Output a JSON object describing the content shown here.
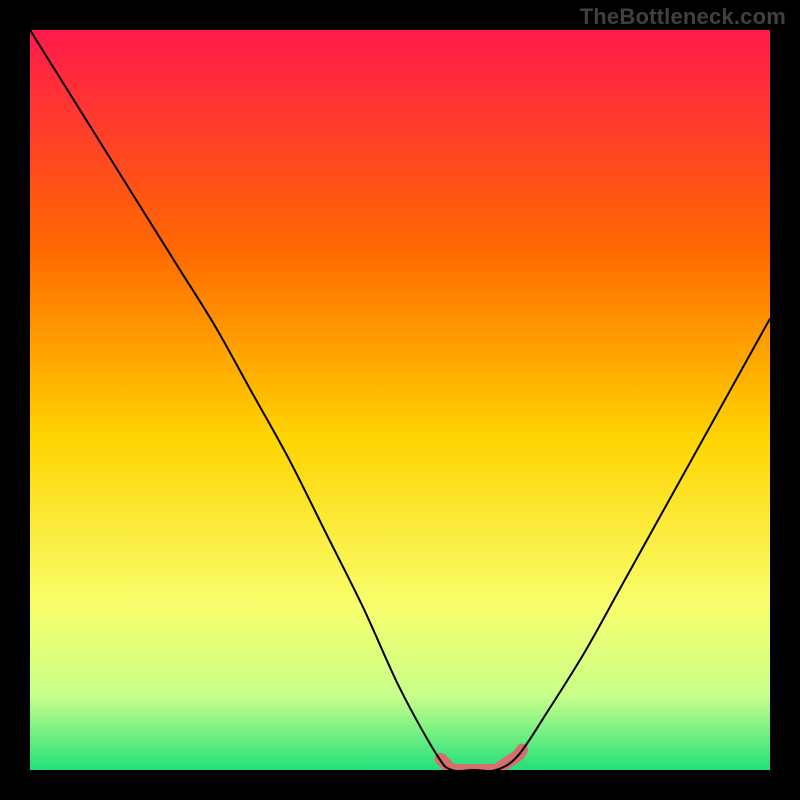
{
  "watermark_text": "TheBottleneck.com",
  "colors": {
    "background": "#000000",
    "curve": "#000000",
    "highlight": "#d86d6d",
    "gradient_top": "#ff1a4b",
    "gradient_mid_upper": "#ff6a00",
    "gradient_mid": "#ffd400",
    "gradient_mid_lower": "#f8ff6e",
    "gradient_low": "#c8ff8a",
    "gradient_bottom": "#22e07a"
  },
  "chart_data": {
    "type": "line",
    "title": "",
    "xlabel": "",
    "ylabel": "",
    "x": [
      0.0,
      0.05,
      0.1,
      0.15,
      0.2,
      0.25,
      0.3,
      0.35,
      0.4,
      0.45,
      0.5,
      0.55,
      0.57,
      0.6,
      0.63,
      0.66,
      0.7,
      0.75,
      0.8,
      0.85,
      0.9,
      0.95,
      1.0
    ],
    "values": [
      1.0,
      0.92,
      0.84,
      0.76,
      0.68,
      0.6,
      0.51,
      0.42,
      0.32,
      0.22,
      0.11,
      0.02,
      0.0,
      0.0,
      0.0,
      0.02,
      0.08,
      0.16,
      0.25,
      0.34,
      0.43,
      0.52,
      0.61
    ],
    "xlim": [
      0,
      1
    ],
    "ylim": [
      0,
      1
    ],
    "grid": false,
    "legend": false,
    "highlight_domain": [
      0.555,
      0.665
    ],
    "background_gradient": {
      "direction": "vertical",
      "semantics": "red-high yellow-mid green-low heatmap",
      "stops": [
        {
          "offset": 0.0,
          "color": "#ff1a4b"
        },
        {
          "offset": 0.3,
          "color": "#ff6a00"
        },
        {
          "offset": 0.55,
          "color": "#ffd400"
        },
        {
          "offset": 0.78,
          "color": "#f8ff6e"
        },
        {
          "offset": 0.9,
          "color": "#c8ff8a"
        },
        {
          "offset": 1.0,
          "color": "#22e07a"
        }
      ]
    }
  }
}
